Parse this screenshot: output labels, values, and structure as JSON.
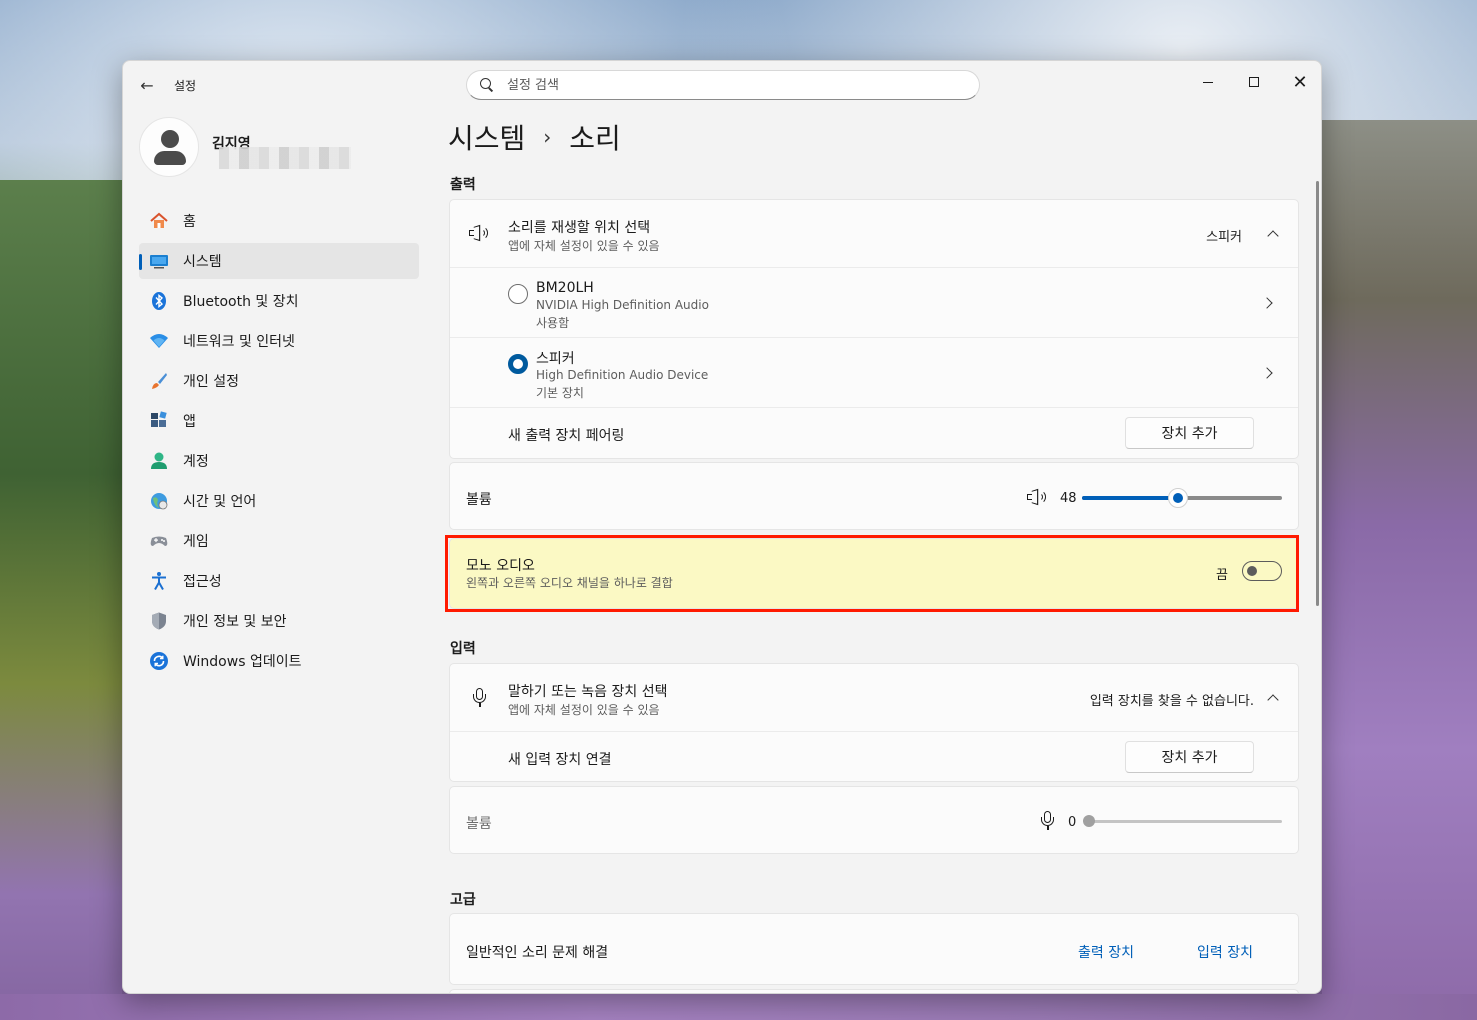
{
  "window": {
    "app_title": "설정",
    "search_placeholder": "설정 검색"
  },
  "profile": {
    "name": "김지영"
  },
  "sidebar": {
    "items": [
      {
        "label": "홈",
        "icon": "home-icon"
      },
      {
        "label": "시스템",
        "icon": "system-icon",
        "active": true
      },
      {
        "label": "Bluetooth 및 장치",
        "icon": "bluetooth-icon"
      },
      {
        "label": "네트워크 및 인터넷",
        "icon": "wifi-icon"
      },
      {
        "label": "개인 설정",
        "icon": "brush-icon"
      },
      {
        "label": "앱",
        "icon": "apps-icon"
      },
      {
        "label": "계정",
        "icon": "account-icon"
      },
      {
        "label": "시간 및 언어",
        "icon": "globe-icon"
      },
      {
        "label": "게임",
        "icon": "gamepad-icon"
      },
      {
        "label": "접근성",
        "icon": "accessibility-icon"
      },
      {
        "label": "개인 정보 및 보안",
        "icon": "shield-icon"
      },
      {
        "label": "Windows 업데이트",
        "icon": "update-icon"
      }
    ]
  },
  "breadcrumb": {
    "parent": "시스템",
    "separator": "›",
    "current": "소리"
  },
  "output": {
    "section_label": "출력",
    "choose_title": "소리를 재생할 위치 선택",
    "choose_sub": "앱에 자체 설정이 있을 수 있음",
    "choose_value": "스피커",
    "devices": [
      {
        "name": "BM20LH",
        "driver": "NVIDIA High Definition Audio",
        "status": "사용함",
        "selected": false
      },
      {
        "name": "스피커",
        "driver": "High Definition Audio Device",
        "status": "기본 장치",
        "selected": true
      }
    ],
    "pair_label": "새 출력 장치 페어링",
    "add_button": "장치 추가",
    "volume_label": "볼륨",
    "volume_value": "48",
    "volume_fraction": 0.48
  },
  "mono": {
    "title": "모노 오디오",
    "sub": "왼쪽과 오른쪽 오디오 채널을 하나로 결합",
    "state_label": "끔",
    "on": false
  },
  "input": {
    "section_label": "입력",
    "choose_title": "말하기 또는 녹음 장치 선택",
    "choose_sub": "앱에 자체 설정이 있을 수 있음",
    "choose_value": "입력 장치를 찾을 수 없습니다.",
    "connect_label": "새 입력 장치 연결",
    "add_button": "장치 추가",
    "volume_label": "볼륨",
    "volume_value": "0",
    "volume_fraction": 0
  },
  "advanced": {
    "section_label": "고급",
    "troubleshoot_label": "일반적인 소리 문제 해결",
    "output_link": "출력 장치",
    "input_link": "입력 장치"
  },
  "colors": {
    "accent": "#005fb8",
    "highlight_fill": "#fbf9c4",
    "highlight_border": "#ff1a00"
  }
}
